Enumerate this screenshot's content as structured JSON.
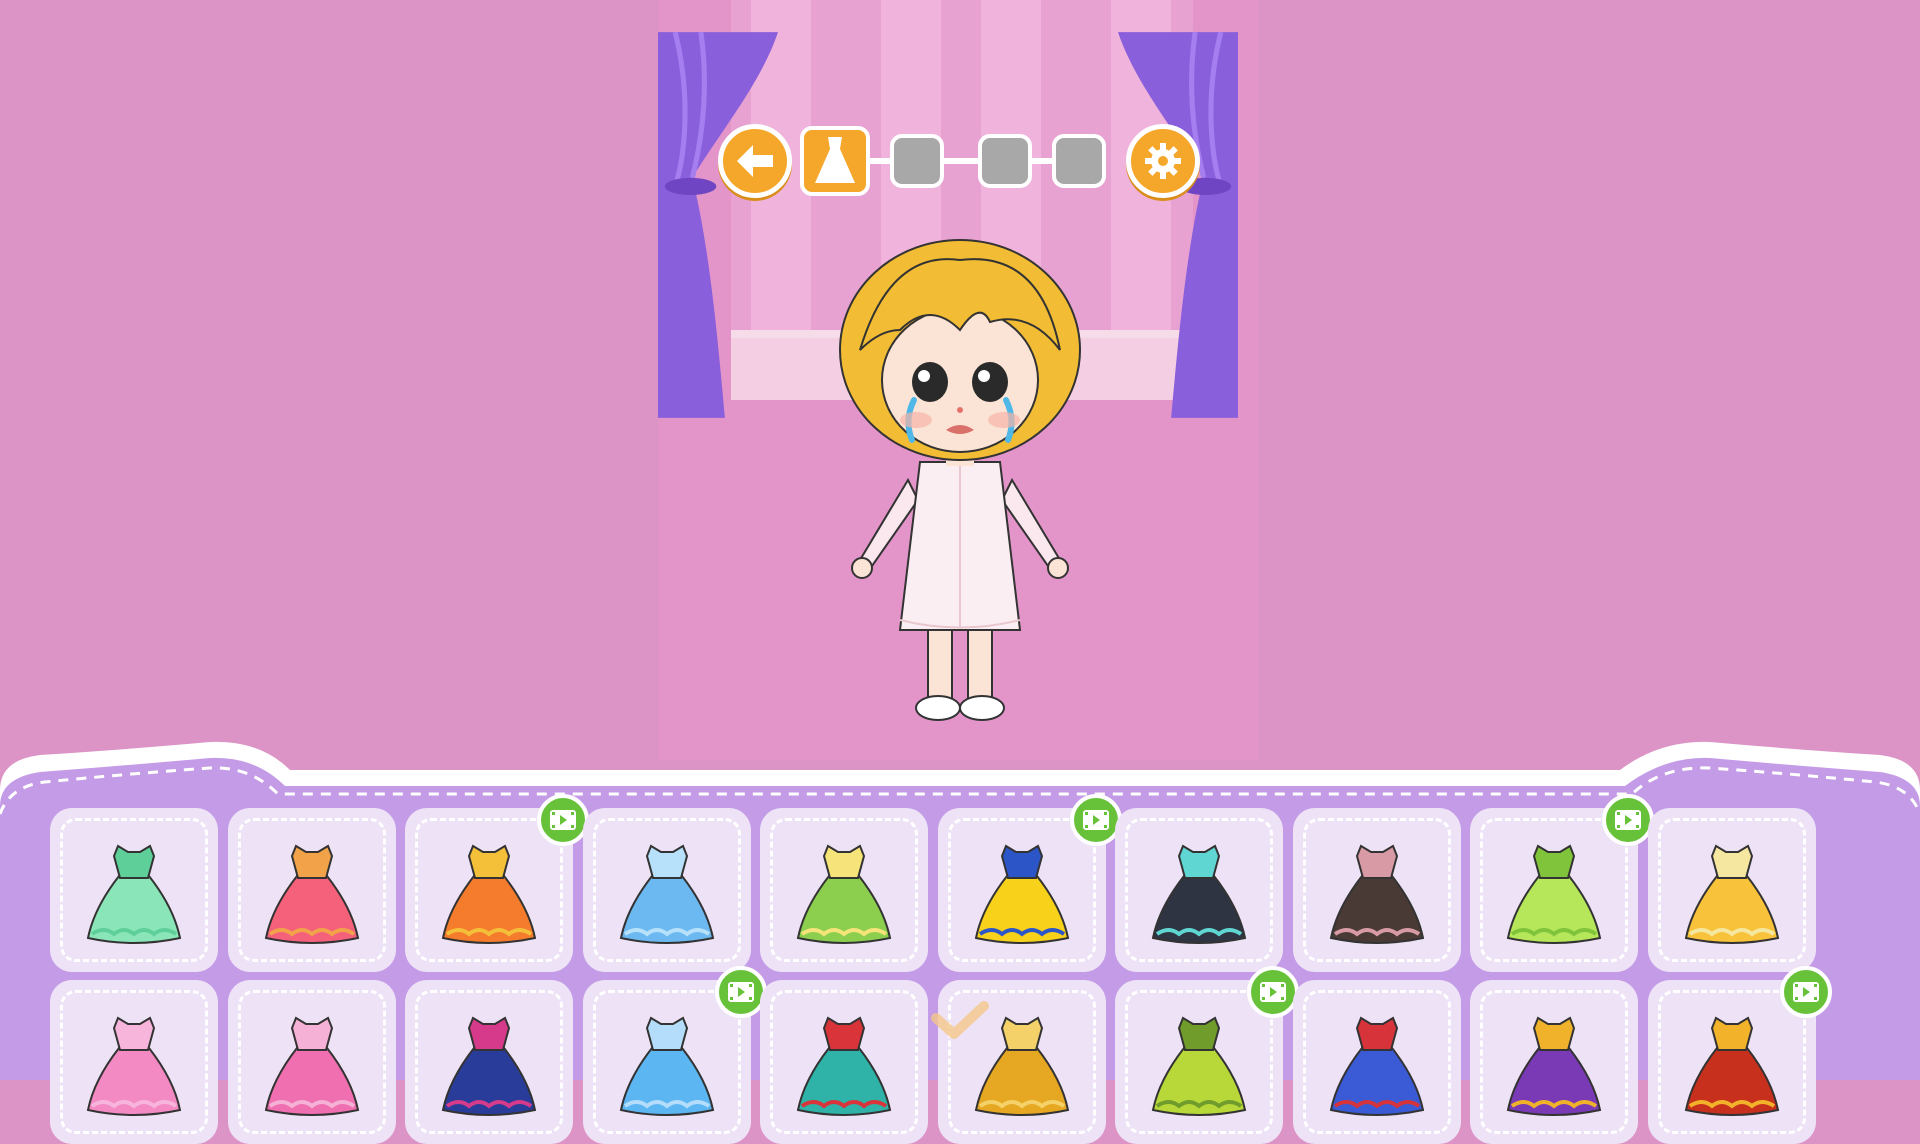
{
  "window": {
    "width": 1920,
    "height": 1080
  },
  "colors": {
    "background": "#dc93c5",
    "curtain": "#8a5fdc",
    "accent_orange": "#f4a72a",
    "panel": "#c49be6",
    "item_bg": "#eee3f6",
    "video_badge": "#67c23a"
  },
  "toolbar": {
    "back_icon": "arrow-left-icon",
    "settings_icon": "gear-icon",
    "steps": [
      {
        "icon": "dress-icon",
        "state": "active"
      },
      {
        "icon": "",
        "state": "locked"
      },
      {
        "icon": "",
        "state": "locked"
      },
      {
        "icon": "",
        "state": "locked"
      }
    ]
  },
  "character": {
    "hair": "blonde-bob",
    "expression": "crying",
    "outfit": "white-dress"
  },
  "wardrobe": {
    "row1": [
      {
        "name": "mint-ballgown",
        "colors": [
          "#8ae6b8",
          "#5fcf9a"
        ],
        "video": false
      },
      {
        "name": "coral-layered-gown",
        "colors": [
          "#f5607a",
          "#f2a34a"
        ],
        "video": false
      },
      {
        "name": "flame-gown",
        "colors": [
          "#f47c2c",
          "#f4c03a"
        ],
        "video": true
      },
      {
        "name": "ice-blue-gown",
        "colors": [
          "#6cb8f0",
          "#b7e1fa"
        ],
        "video": false
      },
      {
        "name": "leaf-gold-gown",
        "colors": [
          "#8ccf4f",
          "#f6e37a"
        ],
        "video": false
      },
      {
        "name": "yellow-blue-gown",
        "colors": [
          "#f8d21a",
          "#2c56c7"
        ],
        "video": true
      },
      {
        "name": "teal-black-outfit",
        "colors": [
          "#2e3442",
          "#5fd6d2"
        ],
        "video": false
      },
      {
        "name": "brown-kimono",
        "colors": [
          "#4a3a35",
          "#d89ba5"
        ],
        "video": false
      },
      {
        "name": "lime-fairy-dress",
        "colors": [
          "#b6e65a",
          "#7fc43a"
        ],
        "video": true
      },
      {
        "name": "golden-ballgown",
        "colors": [
          "#f8c23a",
          "#f6e7a0"
        ],
        "video": false
      }
    ],
    "row2": [
      {
        "name": "pink-gown",
        "colors": [
          "#f48ac4",
          "#f7b5dc"
        ],
        "video": false
      },
      {
        "name": "rose-gown",
        "colors": [
          "#f06fb0",
          "#f5b1d6"
        ],
        "video": false
      },
      {
        "name": "navy-magenta-gown",
        "colors": [
          "#2a3c9a",
          "#d63a8a"
        ],
        "video": false
      },
      {
        "name": "sky-blue-gown",
        "colors": [
          "#5cb6f2",
          "#b3ddfb"
        ],
        "video": true
      },
      {
        "name": "teal-red-armor",
        "colors": [
          "#2fb2a8",
          "#d8343a"
        ],
        "video": false
      },
      {
        "name": "gold-armor",
        "colors": [
          "#e6a822",
          "#f5d16a"
        ],
        "video": false
      },
      {
        "name": "lime-jacket",
        "colors": [
          "#b8d83a",
          "#6f9c2a"
        ],
        "video": true
      },
      {
        "name": "blue-prince-suit",
        "colors": [
          "#3a5ad6",
          "#d6343a"
        ],
        "video": false
      },
      {
        "name": "purple-gold-suit",
        "colors": [
          "#7a3ab6",
          "#f0b22a"
        ],
        "video": false
      },
      {
        "name": "red-gold-royal",
        "colors": [
          "#c8301e",
          "#f2b32a"
        ],
        "video": true
      }
    ]
  }
}
